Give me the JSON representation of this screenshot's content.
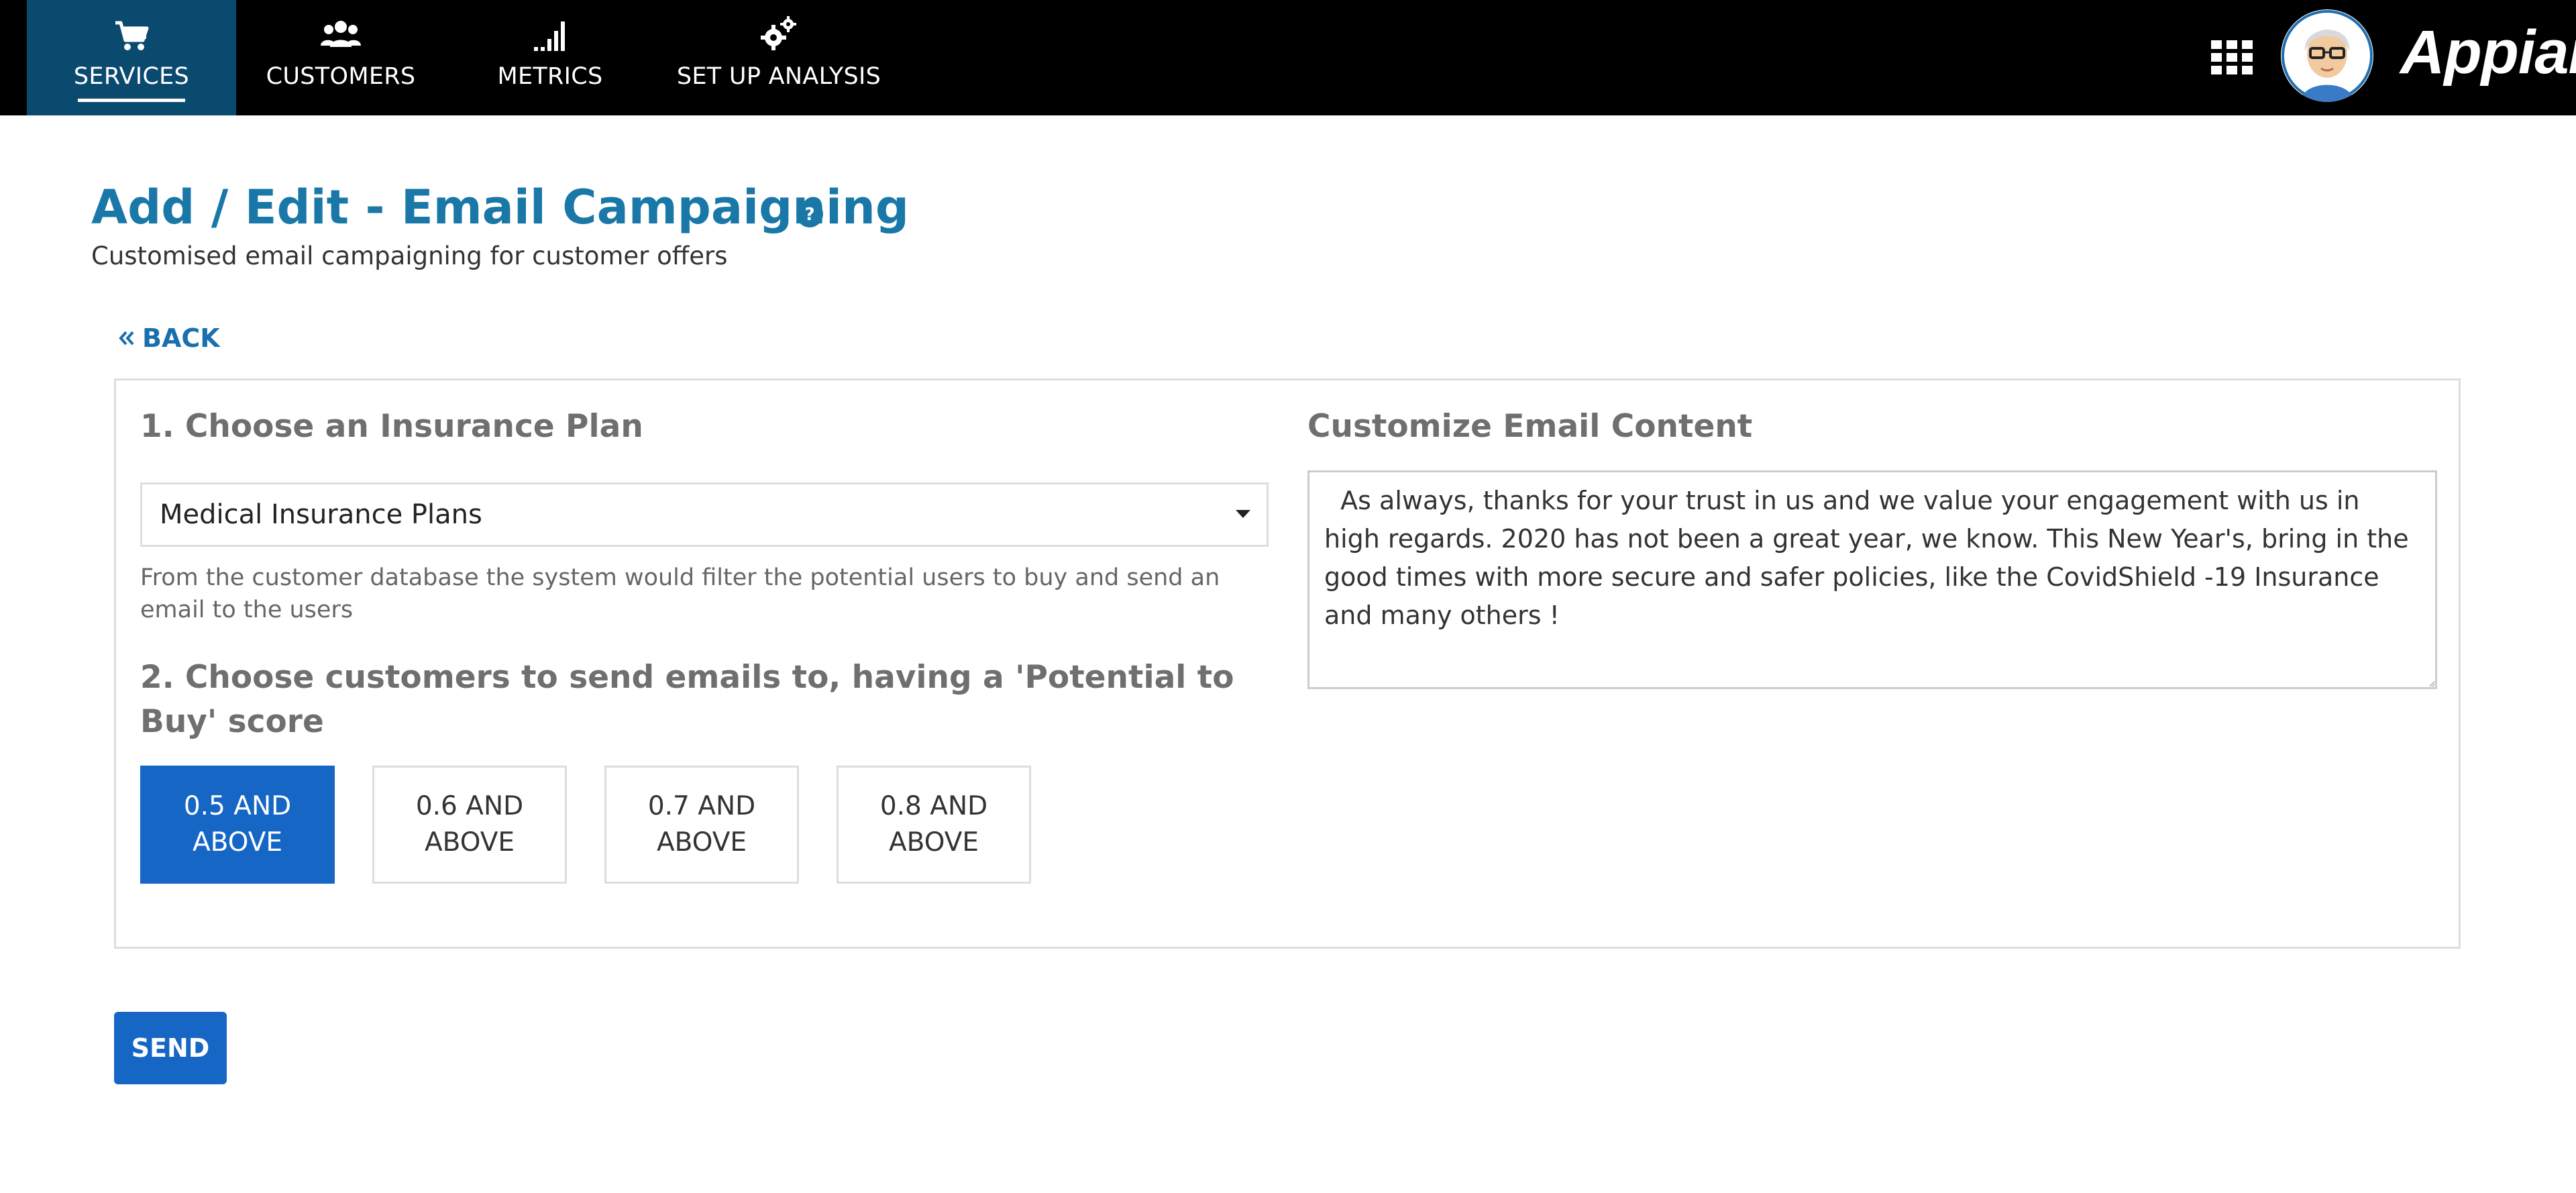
{
  "nav": {
    "tabs": [
      {
        "label": "SERVICES",
        "icon": "cart-icon",
        "active": true
      },
      {
        "label": "CUSTOMERS",
        "icon": "users-icon",
        "active": false
      },
      {
        "label": "METRICS",
        "icon": "signal-bars-icon",
        "active": false
      },
      {
        "label": "SET UP ANALYSIS",
        "icon": "gears-icon",
        "active": false
      }
    ],
    "brand": "Appian",
    "icons": {
      "apps": "apps-grid-icon",
      "avatar": "user-avatar"
    }
  },
  "header": {
    "title": "Add / Edit - Email Campaigning",
    "subtitle": "Customised email campaigning for customer offers",
    "help_icon": "help-icon"
  },
  "back": {
    "label": "BACK",
    "icon": "double-chevron-left-icon"
  },
  "plan_section": {
    "heading": "1. Choose an Insurance Plan",
    "selected": "Medical Insurance Plans",
    "helper": "From the customer database the system would filter the potential users to buy and send an email to the users"
  },
  "score_section": {
    "heading": "2. Choose customers to send emails to, having a 'Potential to Buy' score",
    "options": [
      {
        "label": "0.5 AND ABOVE",
        "selected": true
      },
      {
        "label": "0.6 AND ABOVE",
        "selected": false
      },
      {
        "label": "0.7 AND ABOVE",
        "selected": false
      },
      {
        "label": "0.8 AND ABOVE",
        "selected": false
      }
    ]
  },
  "email_section": {
    "heading": "Customize Email Content",
    "content": "  As always, thanks for your trust in us and we value your engagement with us in high regards. 2020 has not been a great year, we know. This New Year's, bring in the good times with more secure and safer policies, like the CovidShield -19 Insurance and many others !"
  },
  "send": {
    "label": "SEND"
  },
  "colors": {
    "topbar": "#000000",
    "active_tab": "#0b4a6f",
    "title": "#1a78a8",
    "primary": "#1666c5",
    "border": "#dddddd"
  }
}
